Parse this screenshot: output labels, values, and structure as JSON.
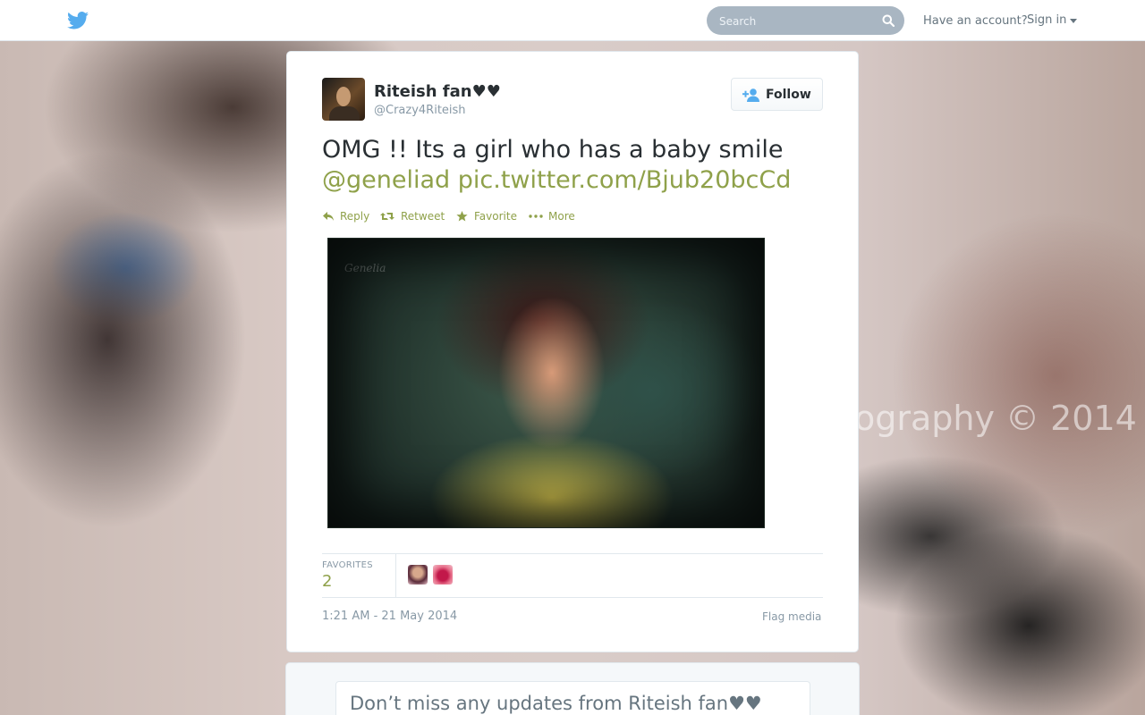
{
  "header": {
    "search": {
      "placeholder": "Search"
    },
    "have_account": "Have an account?",
    "sign_in": "Sign in"
  },
  "background": {
    "watermark": "ography © 2014"
  },
  "tweet": {
    "fullname": "Riteish fan♥♥",
    "username": "@Crazy4Riteish",
    "follow_label": "Follow",
    "text_plain": "OMG !! Its a girl who has a baby smile",
    "mention": "@geneliad",
    "link": "pic.twitter.com/Bjub20bcCd",
    "actions": {
      "reply": "Reply",
      "retweet": "Retweet",
      "favorite": "Favorite",
      "more": "More"
    },
    "favorites_label": "FAVORITES",
    "favorites_count": "2",
    "timestamp": "1:21 AM - 21 May 2014",
    "flag_media": "Flag media"
  },
  "signup": {
    "title": "Don’t miss any updates from Riteish fan♥♥"
  },
  "colors": {
    "link": "#8fa14a",
    "twitter_blue": "#55acee",
    "text": "#292f33",
    "muted": "#8899a6"
  }
}
